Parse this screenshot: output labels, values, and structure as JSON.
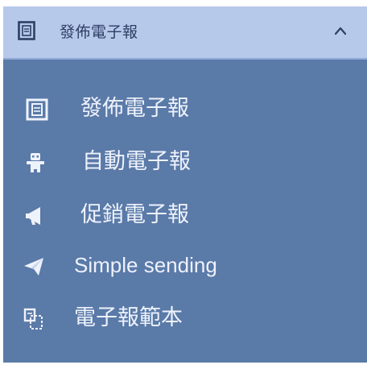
{
  "header": {
    "title": "發佈電子報",
    "icon": "newsletter-icon",
    "chevron": "chevron-up-icon",
    "expanded": true
  },
  "items": [
    {
      "label": "發佈電子報",
      "icon": "newsletter-icon"
    },
    {
      "label": "自動電子報",
      "icon": "robot-icon"
    },
    {
      "label": "促銷電子報",
      "icon": "megaphone-icon"
    },
    {
      "label": "Simple sending",
      "icon": "paper-plane-icon"
    },
    {
      "label": "電子報範本",
      "icon": "template-icon"
    }
  ],
  "colors": {
    "header_bg": "#b7c9ea",
    "menu_bg": "#5a7aa8",
    "item_text": "#eef2fb",
    "header_text": "#2e3e66"
  }
}
